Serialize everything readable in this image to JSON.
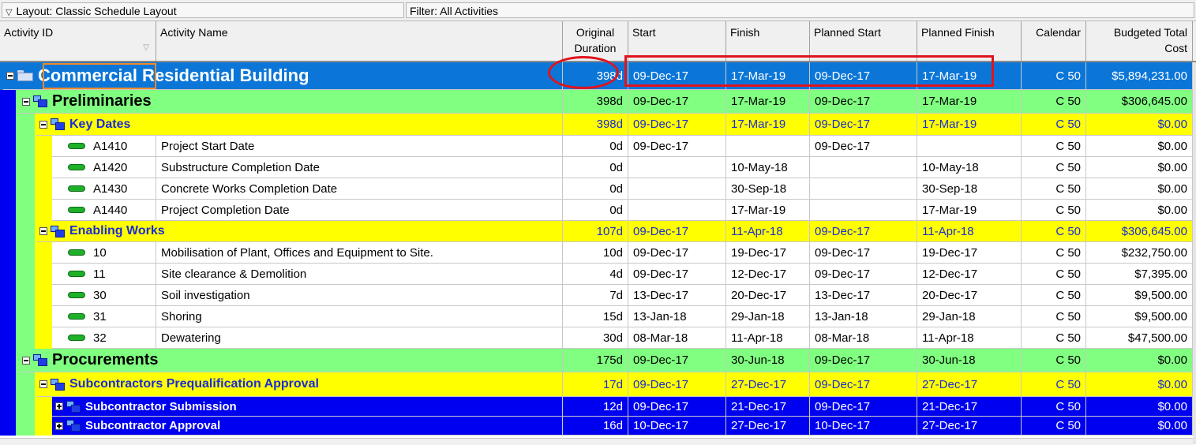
{
  "toolbar": {
    "layout_label": "Layout: Classic Schedule Layout",
    "filter_label": "Filter: All Activities"
  },
  "columns": [
    {
      "key": "id",
      "label": "Activity ID"
    },
    {
      "key": "name",
      "label": "Activity Name"
    },
    {
      "key": "dur",
      "label": "Original Duration"
    },
    {
      "key": "start",
      "label": "Start"
    },
    {
      "key": "finish",
      "label": "Finish"
    },
    {
      "key": "pstart",
      "label": "Planned Start"
    },
    {
      "key": "pfinish",
      "label": "Planned Finish"
    },
    {
      "key": "cal",
      "label": "Calendar"
    },
    {
      "key": "cost",
      "label": "Budgeted Total Cost"
    }
  ],
  "colors": {
    "project": "#0b76d8",
    "wbs_level1": "#80ff80",
    "wbs_level2": "#ffff00",
    "wbs_level3": "#0000f0",
    "highlight": "#e0141e"
  },
  "rows": [
    {
      "type": "project",
      "level": 0,
      "name": "Commercial Residential Building",
      "dur": "398d",
      "start": "09-Dec-17",
      "finish": "17-Mar-19",
      "pstart": "09-Dec-17",
      "pfinish": "17-Mar-19",
      "cal": "C 50",
      "cost": "$5,894,231.00"
    },
    {
      "type": "wbs",
      "level": 1,
      "name": "Preliminaries",
      "dur": "398d",
      "start": "09-Dec-17",
      "finish": "17-Mar-19",
      "pstart": "09-Dec-17",
      "pfinish": "17-Mar-19",
      "cal": "C 50",
      "cost": "$306,645.00"
    },
    {
      "type": "wbs",
      "level": 2,
      "name": "Key Dates",
      "dur": "398d",
      "start": "09-Dec-17",
      "finish": "17-Mar-19",
      "pstart": "09-Dec-17",
      "pfinish": "17-Mar-19",
      "cal": "C 50",
      "cost": "$0.00"
    },
    {
      "type": "activity",
      "level": 3,
      "id": "A1410",
      "name": "Project Start Date",
      "dur": "0d",
      "start": "09-Dec-17",
      "finish": "",
      "pstart": "09-Dec-17",
      "pfinish": "",
      "cal": "C 50",
      "cost": "$0.00"
    },
    {
      "type": "activity",
      "level": 3,
      "id": "A1420",
      "name": "Substructure Completion Date",
      "dur": "0d",
      "start": "",
      "finish": "10-May-18",
      "pstart": "",
      "pfinish": "10-May-18",
      "cal": "C 50",
      "cost": "$0.00"
    },
    {
      "type": "activity",
      "level": 3,
      "id": "A1430",
      "name": "Concrete Works Completion Date",
      "dur": "0d",
      "start": "",
      "finish": "30-Sep-18",
      "pstart": "",
      "pfinish": "30-Sep-18",
      "cal": "C 50",
      "cost": "$0.00"
    },
    {
      "type": "activity",
      "level": 3,
      "id": "A1440",
      "name": "Project Completion Date",
      "dur": "0d",
      "start": "",
      "finish": "17-Mar-19",
      "pstart": "",
      "pfinish": "17-Mar-19",
      "cal": "C 50",
      "cost": "$0.00"
    },
    {
      "type": "wbs",
      "level": 2,
      "name": "Enabling Works",
      "dur": "107d",
      "start": "09-Dec-17",
      "finish": "11-Apr-18",
      "pstart": "09-Dec-17",
      "pfinish": "11-Apr-18",
      "cal": "C 50",
      "cost": "$306,645.00"
    },
    {
      "type": "activity",
      "level": 3,
      "id": "10",
      "name": "Mobilisation of Plant, Offices and Equipment to Site.",
      "dur": "10d",
      "start": "09-Dec-17",
      "finish": "19-Dec-17",
      "pstart": "09-Dec-17",
      "pfinish": "19-Dec-17",
      "cal": "C 50",
      "cost": "$232,750.00"
    },
    {
      "type": "activity",
      "level": 3,
      "id": "11",
      "name": "Site clearance & Demolition",
      "dur": "4d",
      "start": "09-Dec-17",
      "finish": "12-Dec-17",
      "pstart": "09-Dec-17",
      "pfinish": "12-Dec-17",
      "cal": "C 50",
      "cost": "$7,395.00"
    },
    {
      "type": "activity",
      "level": 3,
      "id": "30",
      "name": "Soil investigation",
      "dur": "7d",
      "start": "13-Dec-17",
      "finish": "20-Dec-17",
      "pstart": "13-Dec-17",
      "pfinish": "20-Dec-17",
      "cal": "C 50",
      "cost": "$9,500.00"
    },
    {
      "type": "activity",
      "level": 3,
      "id": "31",
      "name": "Shoring",
      "dur": "15d",
      "start": "13-Jan-18",
      "finish": "29-Jan-18",
      "pstart": "13-Jan-18",
      "pfinish": "29-Jan-18",
      "cal": "C 50",
      "cost": "$9,500.00"
    },
    {
      "type": "activity",
      "level": 3,
      "id": "32",
      "name": "Dewatering",
      "dur": "30d",
      "start": "08-Mar-18",
      "finish": "11-Apr-18",
      "pstart": "08-Mar-18",
      "pfinish": "11-Apr-18",
      "cal": "C 50",
      "cost": "$47,500.00"
    },
    {
      "type": "wbs",
      "level": 1,
      "name": "Procurements",
      "dur": "175d",
      "start": "09-Dec-17",
      "finish": "30-Jun-18",
      "pstart": "09-Dec-17",
      "pfinish": "30-Jun-18",
      "cal": "C 50",
      "cost": "$0.00"
    },
    {
      "type": "wbs",
      "level": 2,
      "name": "Subcontractors Prequalification Approval",
      "dur": "17d",
      "start": "09-Dec-17",
      "finish": "27-Dec-17",
      "pstart": "09-Dec-17",
      "pfinish": "27-Dec-17",
      "cal": "C 50",
      "cost": "$0.00"
    },
    {
      "type": "wbs",
      "level": 3,
      "collapsed": true,
      "name": "Subcontractor Submission",
      "dur": "12d",
      "start": "09-Dec-17",
      "finish": "21-Dec-17",
      "pstart": "09-Dec-17",
      "pfinish": "21-Dec-17",
      "cal": "C 50",
      "cost": "$0.00"
    },
    {
      "type": "wbs",
      "level": 3,
      "collapsed": true,
      "name": "Subcontractor Approval",
      "dur": "16d",
      "start": "10-Dec-17",
      "finish": "27-Dec-17",
      "pstart": "10-Dec-17",
      "pfinish": "27-Dec-17",
      "cal": "C 50",
      "cost": "$0.00"
    }
  ]
}
